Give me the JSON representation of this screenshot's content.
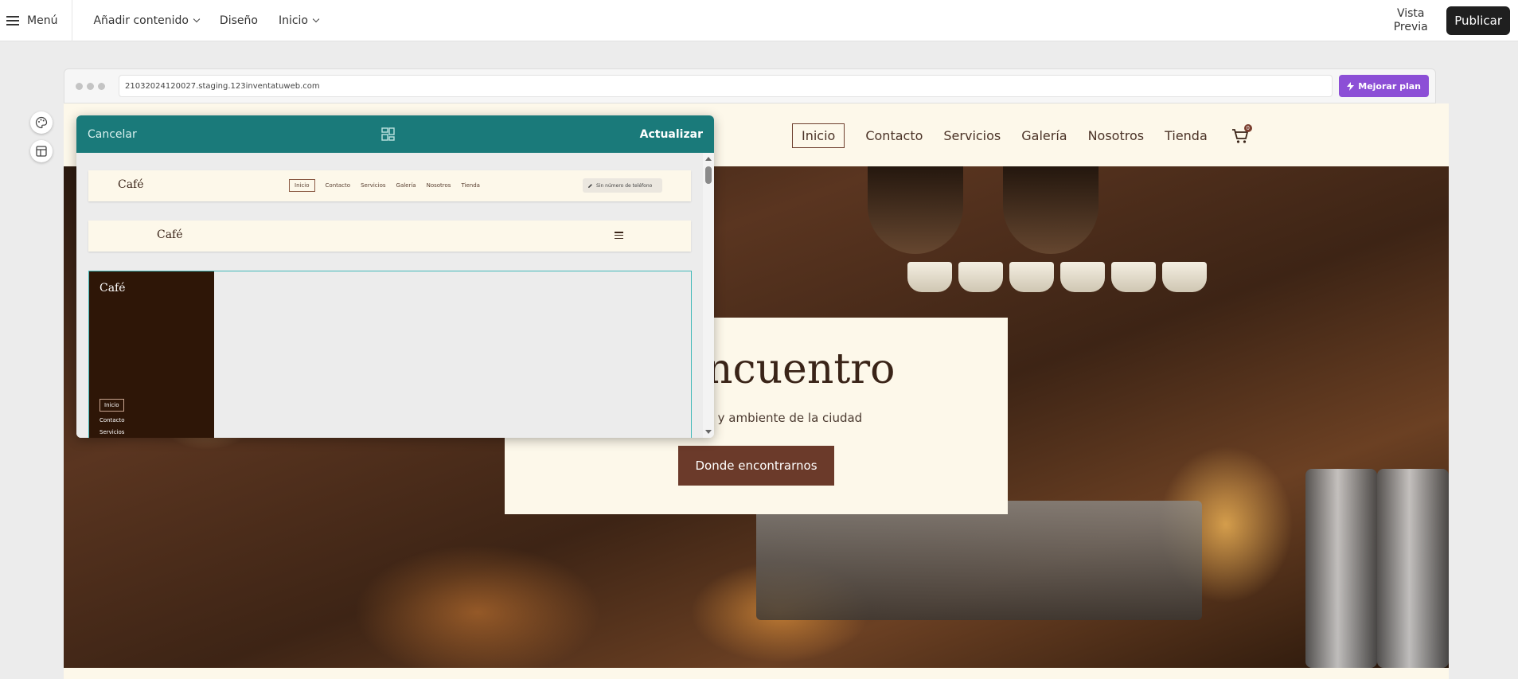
{
  "topbar": {
    "menu_label": "Menú",
    "add_content_label": "Añadir contenido",
    "design_label": "Diseño",
    "page_label": "Inicio",
    "preview_label": "Vista Previa",
    "publish_label": "Publicar"
  },
  "browser": {
    "url": "21032024120027.staging.123inventatuweb.com",
    "upgrade_label": "Mejorar plan"
  },
  "site": {
    "nav": [
      "Inicio",
      "Contacto",
      "Servicios",
      "Galería",
      "Nosotros",
      "Tienda"
    ],
    "cart_count": "0",
    "hero_title": "de encuentro",
    "hero_subtitle": "mejor café y ambiente de la ciudad",
    "hero_button": "Donde encontrarnos"
  },
  "panel": {
    "cancel_label": "Cancelar",
    "update_label": "Actualizar",
    "logo_text": "Café",
    "option1_nav": [
      "Inicio",
      "Contacto",
      "Servicios",
      "Galería",
      "Nosotros",
      "Tienda"
    ],
    "option1_phone": "Sin número de teléfono",
    "option3_nav": [
      "Inicio",
      "Contacto",
      "Servicios"
    ]
  },
  "colors": {
    "editor_accent": "#1a7a7a",
    "upgrade": "#8c4fd6",
    "site_cream": "#fdf8ea",
    "site_brown": "#6b3a2a",
    "sidebar_dark": "#2e1607"
  },
  "icons": {
    "menu": "hamburger-icon",
    "cart": "cart-icon",
    "palette": "palette-icon",
    "layout": "layout-icon",
    "template": "template-grid-icon",
    "bolt": "bolt-icon",
    "pencil": "pencil-icon"
  }
}
